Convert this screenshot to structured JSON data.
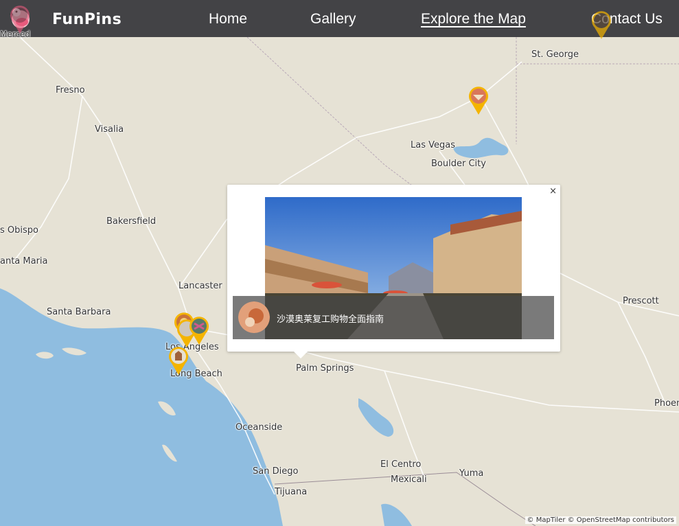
{
  "brand": {
    "name": "FunPins"
  },
  "nav": {
    "home": "Home",
    "gallery": "Gallery",
    "explore": "Explore the Map",
    "contact": "Contact Us"
  },
  "map": {
    "places": {
      "merced": "Merced",
      "st_george": "St. George",
      "fresno": "Fresno",
      "visalia": "Visalia",
      "las_vegas": "Las Vegas",
      "boulder_city": "Boulder City",
      "obispo": "s Obispo",
      "bakersfield": "Bakersfield",
      "santa_maria": "anta Maria",
      "lancaster": "Lancaster",
      "prescott": "Prescott",
      "santa_barbara": "Santa Barbara",
      "los_angeles": "Los Angeles",
      "long_beach": "Long Beach",
      "palm_springs": "Palm Springs",
      "phoenix": "Phoen",
      "oceanside": "Oceanside",
      "el_centro": "El Centro",
      "san_diego": "San Diego",
      "mexicali": "Mexicali",
      "yuma": "Yuma",
      "tijuana": "Tijuana"
    },
    "colors": {
      "land": "#e6e2d5",
      "water": "#8fbde0",
      "pin": "#f4b400"
    }
  },
  "popup": {
    "close": "×",
    "caption": "沙漠奥莱复工购物全面指南"
  },
  "attribution": "© MapTiler © OpenStreetMap contributors"
}
